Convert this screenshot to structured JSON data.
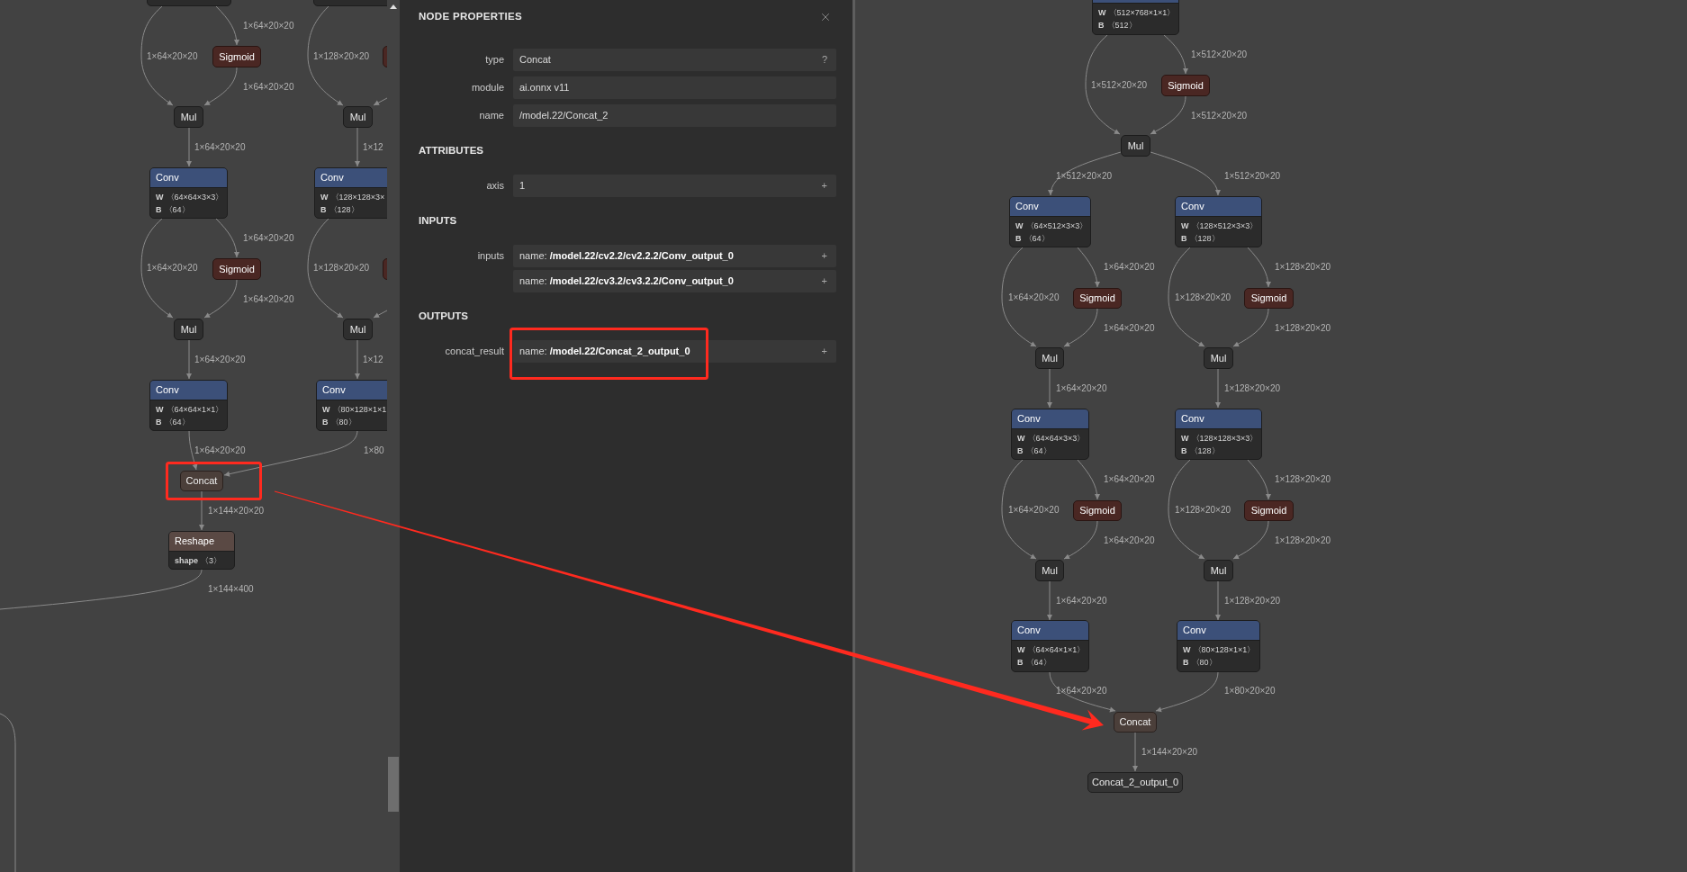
{
  "left_graph": {
    "nodes": [
      {
        "kind": "conv"
      },
      {
        "kind": "conv"
      },
      {
        "kind": "sigmoid",
        "title": "Sigmoid"
      },
      {
        "kind": "sigmoid"
      },
      {
        "kind": "mul",
        "title": "Mul"
      },
      {
        "kind": "mul",
        "title": "Mul"
      },
      {
        "kind": "conv",
        "title": "Conv",
        "attributes": [
          {
            "name": "W",
            "value": "〈64×64×3×3〉"
          },
          {
            "name": "B",
            "value": "〈64〉"
          }
        ]
      },
      {
        "kind": "conv",
        "title": "Conv",
        "attributes": [
          {
            "name": "W",
            "value": "〈128×128×3×"
          },
          {
            "name": "B",
            "value": "〈128〉"
          }
        ]
      },
      {
        "kind": "sigmoid",
        "title": "Sigmoid"
      },
      {
        "kind": "sigmoid"
      },
      {
        "kind": "mul",
        "title": "Mul"
      },
      {
        "kind": "mul",
        "title": "Mul"
      },
      {
        "kind": "conv",
        "title": "Conv",
        "attributes": [
          {
            "name": "W",
            "value": "〈64×64×1×1〉"
          },
          {
            "name": "B",
            "value": "〈64〉"
          }
        ]
      },
      {
        "kind": "conv",
        "title": "Conv",
        "attributes": [
          {
            "name": "W",
            "value": "〈80×128×1×1"
          },
          {
            "name": "B",
            "value": "〈80〉"
          }
        ]
      },
      {
        "kind": "concat",
        "title": "Concat"
      },
      {
        "kind": "reshape",
        "title": "Reshape",
        "attributes": [
          {
            "name": "shape",
            "value": "〈3〉"
          }
        ]
      }
    ],
    "edge_labels": [
      "1×64×20×20",
      "1×64×20×20",
      "1×128×20×20",
      "1×64×20×20",
      "1×64×20×20",
      "1×12",
      "1×64×20×20",
      "1×64×20×20",
      "1×128×20×20",
      "1×64×20×20",
      "1×64×20×20",
      "1×12",
      "1×64×20×20",
      "1×80",
      "1×144×20×20",
      "1×144×400"
    ]
  },
  "node_properties": {
    "title": "NODE PROPERTIES",
    "sections": [
      {
        "rows": [
          {
            "label": "type",
            "values": [
              {
                "text": "Concat",
                "action": "?"
              }
            ]
          },
          {
            "label": "module",
            "values": [
              {
                "text": "ai.onnx v11"
              }
            ]
          },
          {
            "label": "name",
            "values": [
              {
                "text": "/model.22/Concat_2"
              }
            ]
          }
        ]
      },
      {
        "heading": "ATTRIBUTES",
        "rows": [
          {
            "label": "axis",
            "values": [
              {
                "text": "1",
                "action": "+"
              }
            ]
          }
        ]
      },
      {
        "heading": "INPUTS",
        "rows": [
          {
            "label": "inputs",
            "values": [
              {
                "text": "name: **/model.22/cv2.2/cv2.2.2/Conv_output_0**",
                "action": "+"
              },
              {
                "text": "name: **/model.22/cv3.2/cv3.2.2/Conv_output_0**",
                "action": "+"
              }
            ]
          }
        ]
      },
      {
        "heading": "OUTPUTS",
        "rows": [
          {
            "label": "concat_result",
            "values": [
              {
                "text": "name: **/model.22/Concat_2_output_0**",
                "action": "+"
              }
            ]
          }
        ]
      }
    ]
  },
  "right_graph": {
    "nodes": [
      {
        "kind": "conv",
        "attributes": [
          {
            "name": "W",
            "value": "〈512×768×1×1〉"
          },
          {
            "name": "B",
            "value": "〈512〉"
          }
        ]
      },
      {
        "kind": "sigmoid",
        "title": "Sigmoid"
      },
      {
        "kind": "mul",
        "title": "Mul"
      },
      {
        "kind": "conv",
        "title": "Conv",
        "attributes": [
          {
            "name": "W",
            "value": "〈64×512×3×3〉"
          },
          {
            "name": "B",
            "value": "〈64〉"
          }
        ]
      },
      {
        "kind": "conv",
        "title": "Conv",
        "attributes": [
          {
            "name": "W",
            "value": "〈128×512×3×3〉"
          },
          {
            "name": "B",
            "value": "〈128〉"
          }
        ]
      },
      {
        "kind": "sigmoid",
        "title": "Sigmoid"
      },
      {
        "kind": "sigmoid",
        "title": "Sigmoid"
      },
      {
        "kind": "mul",
        "title": "Mul"
      },
      {
        "kind": "mul",
        "title": "Mul"
      },
      {
        "kind": "conv",
        "title": "Conv",
        "attributes": [
          {
            "name": "W",
            "value": "〈64×64×3×3〉"
          },
          {
            "name": "B",
            "value": "〈64〉"
          }
        ]
      },
      {
        "kind": "conv",
        "title": "Conv",
        "attributes": [
          {
            "name": "W",
            "value": "〈128×128×3×3〉"
          },
          {
            "name": "B",
            "value": "〈128〉"
          }
        ]
      },
      {
        "kind": "sigmoid",
        "title": "Sigmoid"
      },
      {
        "kind": "sigmoid",
        "title": "Sigmoid"
      },
      {
        "kind": "mul",
        "title": "Mul"
      },
      {
        "kind": "mul",
        "title": "Mul"
      },
      {
        "kind": "conv",
        "title": "Conv",
        "attributes": [
          {
            "name": "W",
            "value": "〈64×64×1×1〉"
          },
          {
            "name": "B",
            "value": "〈64〉"
          }
        ]
      },
      {
        "kind": "conv",
        "title": "Conv",
        "attributes": [
          {
            "name": "W",
            "value": "〈80×128×1×1〉"
          },
          {
            "name": "B",
            "value": "〈80〉"
          }
        ]
      },
      {
        "kind": "concat",
        "title": "Concat"
      },
      {
        "kind": "output",
        "title": "Concat_2_output_0"
      }
    ],
    "edge_labels": [
      "1×512×20×20",
      "1×512×20×20",
      "1×512×20×20",
      "1×512×20×20",
      "1×512×20×20",
      "1×64×20×20",
      "1×128×20×20",
      "1×64×20×20",
      "1×128×20×20",
      "1×64×20×20",
      "1×128×20×20",
      "1×64×20×20",
      "1×128×20×20",
      "1×64×20×20",
      "1×128×20×20",
      "1×64×20×20",
      "1×128×20×20",
      "1×64×20×20",
      "1×128×20×20",
      "1×64×20×20",
      "1×128×20×20",
      "1×64×20×20",
      "1×80×20×20",
      "1×144×20×20"
    ]
  }
}
